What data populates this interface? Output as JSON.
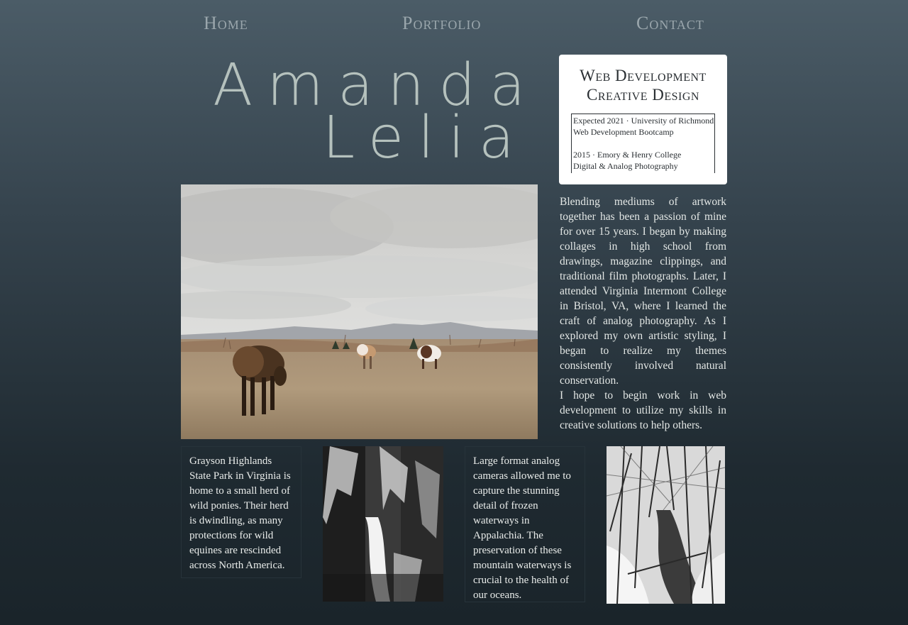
{
  "nav": {
    "home": "Home",
    "portfolio": "Portfolio",
    "contact": "Contact"
  },
  "hero": {
    "first_name": "Amanda",
    "last_name": "Lelia"
  },
  "card": {
    "title_line1": "Web Development",
    "title_line2": "Creative Design",
    "education": [
      {
        "line1": "Expected 2021 · University of Richmond",
        "line2": "Web Development Bootcamp"
      },
      {
        "line1": "2015 · Emory & Henry College",
        "line2": "Digital & Analog Photography"
      }
    ]
  },
  "bio": {
    "paragraph1": "Blending mediums of artwork together has been a passion of mine for over 15 years. I began by making collages in high school from drawings, magazine clippings, and traditional film photographs. Later, I attended Virginia Intermont College in Bristol, VA, where I learned the craft of analog photography. As I explored my own artistic styling, I began to realize my themes consistently involved natural conservation.",
    "paragraph2": "I hope to begin work in web development to utilize my skills in creative solutions to help others."
  },
  "captions": {
    "ponies": "Grayson Highlands State Park in Virginia is home to a small herd of wild ponies. Their herd is dwindling, as many protections for wild equines are rescinded across North America.",
    "waterways": "Large format analog cameras allowed me to capture the stunning detail of frozen waterways in Appalachia. The preservation of these mountain waterways is crucial to the health of our oceans."
  },
  "colors": {
    "nav_text": "#9aa6ac",
    "hero_text": "#b5c1bd",
    "card_bg": "#ffffff",
    "body_text": "#e4e8e6",
    "bg_top": "#4b5c67",
    "bg_bottom": "#1a242a"
  }
}
